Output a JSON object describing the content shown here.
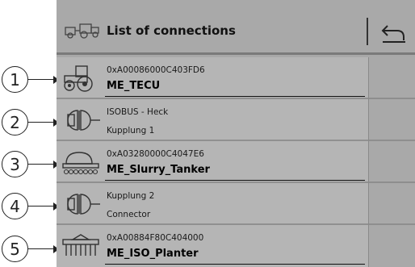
{
  "header": {
    "title": "List of connections",
    "icon": "tractor-implement-icon",
    "back_icon": "back-return-icon"
  },
  "callouts": [
    "1",
    "2",
    "3",
    "4",
    "5"
  ],
  "connections": [
    {
      "line1": "0xA00086000C403FD6",
      "line2": "ME_TECU",
      "icon": "tractor-icon",
      "bold": true
    },
    {
      "line1": "ISOBUS - Heck",
      "line2": "Kupplung 1",
      "icon": "connector-icon",
      "bold": false
    },
    {
      "line1": "0xA03280000C4047E6",
      "line2": "ME_Slurry_Tanker",
      "icon": "slurry-tanker-icon",
      "bold": true
    },
    {
      "line1": "Kupplung 2",
      "line2": "Connector",
      "icon": "connector-icon",
      "bold": false
    },
    {
      "line1": "0xA00884F80C404000",
      "line2": "ME_ISO_Planter",
      "icon": "planter-icon",
      "bold": true
    }
  ],
  "colors": {
    "panel": "#a9a9a9",
    "list": "#b5b5b5",
    "text": "#111111"
  }
}
